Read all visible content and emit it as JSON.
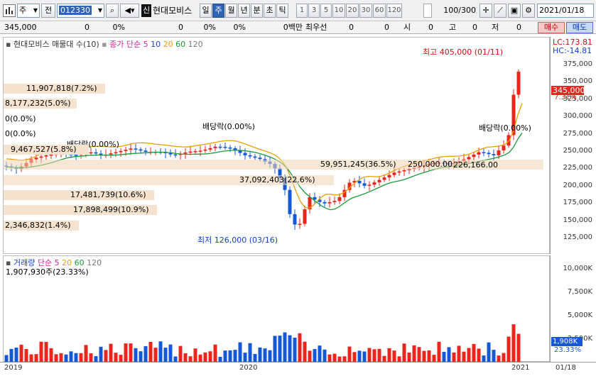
{
  "toolbar": {
    "market_selector": "주",
    "period_mode": "전",
    "stock_code": "012330",
    "badge": "신",
    "stock_name": "현대모비스",
    "periods": [
      "일",
      "주",
      "월",
      "년",
      "분",
      "초",
      "틱"
    ],
    "selected_period": "주",
    "numbers": [
      "1",
      "3",
      "5",
      "10",
      "20",
      "30",
      "60",
      "120"
    ],
    "count_value": "100",
    "count_total": "/300",
    "date": "2021/01/18"
  },
  "quote_bar": {
    "price": "345,000",
    "change": "0",
    "change_rate": "0%",
    "volume": "0",
    "volume_rate": "0%",
    "ratio": "0%",
    "limit_label": "0백만",
    "priority_label": "최우선",
    "priority_value": "0",
    "v1": "0",
    "open_label": "시",
    "open_value": "0",
    "high_label": "고",
    "high_value": "0",
    "low_label": "저",
    "low_value": "0",
    "buy_button": "매수",
    "sell_button": "매도"
  },
  "price_pane": {
    "legend_title": "현대모비스 매물대 수(10)",
    "legend_ma_label": "종가 단순",
    "legend_ma_periods": [
      "5",
      "10",
      "20",
      "60",
      "120"
    ],
    "lc_label": "LC:173.81",
    "hc_label": "HC:-14.81",
    "current_price_tag": "345,000",
    "current_rate_tag": "7.31%",
    "y_ticks": [
      "375,000",
      "350,000",
      "325,000",
      "300,000",
      "275,000",
      "250,000",
      "225,000",
      "200,000",
      "175,000",
      "150,000",
      "125,000"
    ],
    "high_annotation": "최고 405,000 (01/11)",
    "low_annotation": "최저 126,000 (03/16)",
    "dividend_labels": [
      "배당락(0.00%)",
      "배당락(0.00%)",
      "배당락(0.00%)"
    ],
    "volume_profile_labels": [
      "11,907,818(7.2%)",
      "8,177,232(5.0%)",
      "0(0.0%)",
      "0(0.0%)",
      "9,467,527(5.8%)",
      "59,951,245(36.5%)",
      "37,092,403(22.6%)",
      "17,481,739(10.6%)",
      "17,898,499(10.9%)",
      "2,346,832(1.4%)"
    ],
    "overlay_annotations": [
      "250,000.00",
      "226,166.00"
    ]
  },
  "volume_pane": {
    "legend_title": "거래량",
    "legend_ma_label": "단순",
    "legend_ma_periods": [
      "5",
      "20",
      "60",
      "120"
    ],
    "current_volume": "1,907,930주(23.33%)",
    "y_ticks": [
      "10,000K",
      "7,500K",
      "5,000K",
      "2,500K"
    ],
    "current_volume_tag": "1,908K",
    "current_volume_rate": "23.33%"
  },
  "x_axis": {
    "labels": [
      "2019",
      "2020",
      "2021"
    ],
    "date_tag": "01/18"
  },
  "colors": {
    "up": "#e8261e",
    "down": "#1458d6",
    "ma5": "#cc2a9a",
    "ma10": "#2040c0",
    "ma20": "#e8a000",
    "ma60": "#1a9a3a",
    "ma120": "#7a7a7a"
  }
}
